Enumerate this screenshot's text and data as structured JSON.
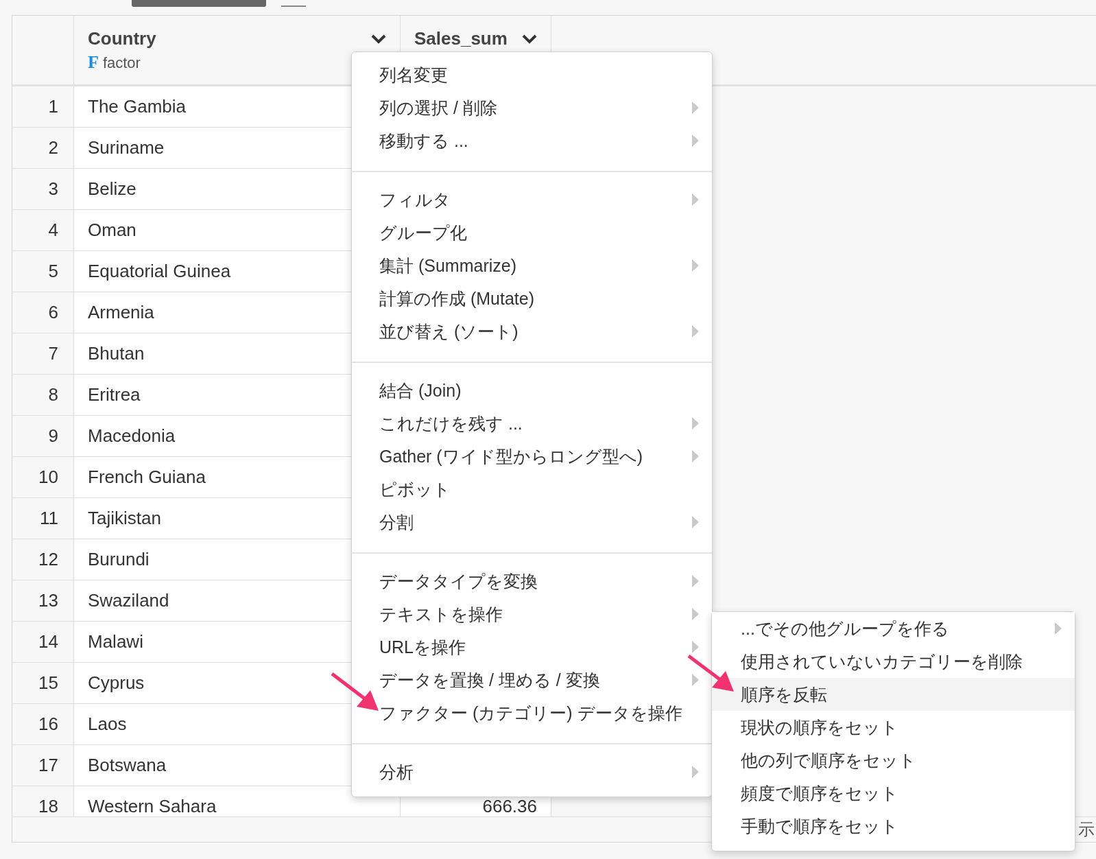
{
  "table": {
    "columns": [
      {
        "name": "Country",
        "type_icon": "F",
        "type": "factor"
      },
      {
        "name": "Sales_sum"
      }
    ],
    "rows": [
      {
        "number": "1",
        "country": "The Gambia"
      },
      {
        "number": "2",
        "country": "Suriname"
      },
      {
        "number": "3",
        "country": "Belize"
      },
      {
        "number": "4",
        "country": "Oman"
      },
      {
        "number": "5",
        "country": "Equatorial Guinea"
      },
      {
        "number": "6",
        "country": "Armenia"
      },
      {
        "number": "7",
        "country": "Bhutan"
      },
      {
        "number": "8",
        "country": "Eritrea"
      },
      {
        "number": "9",
        "country": "Macedonia"
      },
      {
        "number": "10",
        "country": "French Guiana"
      },
      {
        "number": "11",
        "country": "Tajikistan"
      },
      {
        "number": "12",
        "country": "Burundi"
      },
      {
        "number": "13",
        "country": "Swaziland"
      },
      {
        "number": "14",
        "country": "Malawi"
      },
      {
        "number": "15",
        "country": "Cyprus"
      },
      {
        "number": "16",
        "country": "Laos"
      },
      {
        "number": "17",
        "country": "Botswana"
      },
      {
        "number": "18",
        "country": "Western Sahara",
        "sales_sum": "666.36"
      }
    ],
    "footer_text": "示"
  },
  "context_menu": {
    "sections": [
      [
        {
          "label": "列名変更",
          "submenu": false
        },
        {
          "label": "列の選択 / 削除",
          "submenu": true
        },
        {
          "label": "移動する ...",
          "submenu": true
        }
      ],
      [
        {
          "label": "フィルタ",
          "submenu": true
        },
        {
          "label": "グループ化",
          "submenu": false
        },
        {
          "label": "集計 (Summarize)",
          "submenu": true
        },
        {
          "label": "計算の作成 (Mutate)",
          "submenu": false
        },
        {
          "label": "並び替え (ソート)",
          "submenu": true
        }
      ],
      [
        {
          "label": "結合 (Join)",
          "submenu": false
        },
        {
          "label": "これだけを残す ...",
          "submenu": true
        },
        {
          "label": "Gather (ワイド型からロング型へ)",
          "submenu": true
        },
        {
          "label": "ピボット",
          "submenu": false
        },
        {
          "label": "分割",
          "submenu": true
        }
      ],
      [
        {
          "label": "データタイプを変換",
          "submenu": true
        },
        {
          "label": "テキストを操作",
          "submenu": true
        },
        {
          "label": "URLを操作",
          "submenu": true
        },
        {
          "label": "データを置換 / 埋める / 変換",
          "submenu": true
        },
        {
          "label": "ファクター (カテゴリー) データを操作",
          "submenu": false
        }
      ],
      [
        {
          "label": "分析",
          "submenu": true
        }
      ]
    ]
  },
  "submenu": {
    "items": [
      {
        "label": "...でその他グループを作る",
        "submenu": true,
        "selected": false
      },
      {
        "label": "使用されていないカテゴリーを削除",
        "submenu": false,
        "selected": false
      },
      {
        "label": "順序を反転",
        "submenu": false,
        "selected": true
      },
      {
        "label": "現状の順序をセット",
        "submenu": false,
        "selected": false
      },
      {
        "label": "他の列で順序をセット",
        "submenu": false,
        "selected": false
      },
      {
        "label": "頻度で順序をセット",
        "submenu": false,
        "selected": false
      },
      {
        "label": "手動で順序をセット",
        "submenu": false,
        "selected": false
      }
    ]
  }
}
